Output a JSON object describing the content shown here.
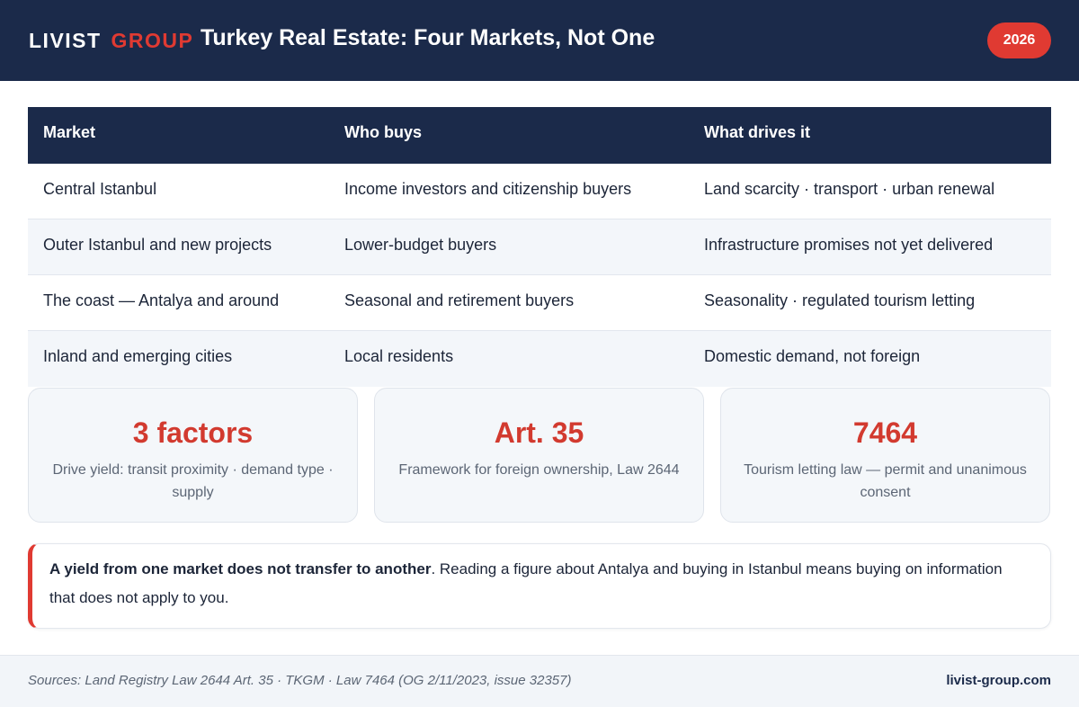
{
  "header": {
    "logo_word1": "LIVIST",
    "logo_word2": "GROUP",
    "title": "Turkey Real Estate: Four Markets, Not One",
    "year_badge": "2026"
  },
  "table": {
    "headers": [
      "Market",
      "Who buys",
      "What drives it"
    ],
    "rows": [
      [
        "Central Istanbul",
        "Income investors and citizenship buyers",
        "Land scarcity · transport · urban renewal"
      ],
      [
        "Outer Istanbul and new projects",
        "Lower-budget buyers",
        "Infrastructure promises not yet delivered"
      ],
      [
        "The coast — Antalya and around",
        "Seasonal and retirement buyers",
        "Seasonality · regulated tourism letting"
      ],
      [
        "Inland and emerging cities",
        "Local residents",
        "Domestic demand, not foreign"
      ]
    ]
  },
  "stats": [
    {
      "value": "3 factors",
      "desc": "Drive yield: transit proximity · demand type · supply"
    },
    {
      "value": "Art. 35",
      "desc": "Framework for foreign ownership, Law 2644"
    },
    {
      "value": "7464",
      "desc": "Tourism letting law — permit and unanimous consent"
    }
  ],
  "callout": {
    "strong": "A yield from one market does not transfer to another",
    "rest": ". Reading a figure about Antalya and buying in Istanbul means buying on information that does not apply to you."
  },
  "footer": {
    "sources": "Sources: Land Registry Law 2644 Art. 35 · TKGM · Law 7464 (OG 2/11/2023, issue 32357)",
    "site": "livist-group.com"
  },
  "colors": {
    "navy": "#1b2a4a",
    "accent_red": "#e03a32",
    "stat_red": "#d23a2f",
    "row_alt": "#f3f6fa"
  }
}
